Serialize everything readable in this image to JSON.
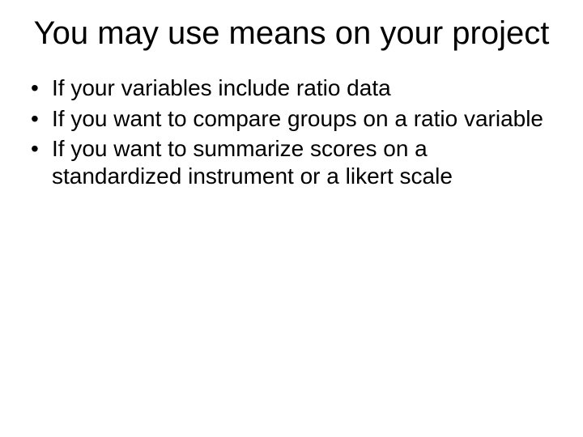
{
  "title": "You may use means on your project",
  "bullets": [
    "If your variables include ratio data",
    "If you want to compare groups on a ratio variable",
    "If you want to summarize scores on a standardized instrument or a likert scale"
  ]
}
